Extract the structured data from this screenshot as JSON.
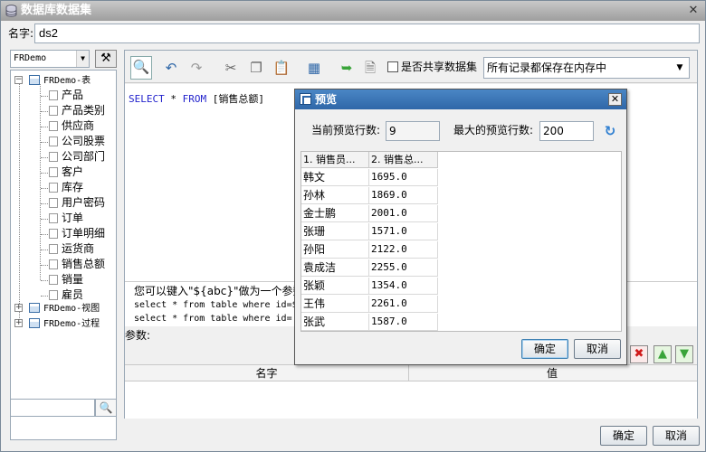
{
  "window": {
    "title": "数据库数据集",
    "close": "✕"
  },
  "name_field": {
    "label": "名字:",
    "value": "ds2"
  },
  "db_select": {
    "value": "FRDemo"
  },
  "tree": {
    "groups": [
      {
        "label": "FRDemo-表",
        "expanded": true
      },
      {
        "label": "FRDemo-视图",
        "expanded": false
      },
      {
        "label": "FRDemo-过程",
        "expanded": false
      }
    ],
    "tables": [
      "产品",
      "产品类别",
      "供应商",
      "公司股票",
      "公司部门",
      "客户",
      "库存",
      "用户密码",
      "订单",
      "订单明细",
      "运货商",
      "销售总额",
      "销量",
      "雇员"
    ]
  },
  "toolbar": {
    "share_label": "是否共享数据集",
    "memory_select": "所有记录都保存在内存中"
  },
  "sql": {
    "select": "SELECT",
    "star": " * ",
    "from": "FROM",
    "table": " [销售总额]"
  },
  "hint": {
    "line1": "您可以键入\"${abc}\"做为一个参数",
    "line2": "select * from table where id=${abc}",
    "line3": "select * from table where id='${abc}'"
  },
  "params": {
    "label": "参数:",
    "col_name": "名字",
    "col_value": "值"
  },
  "buttons": {
    "ok": "确定",
    "cancel": "取消"
  },
  "preview": {
    "title": "预览",
    "current_rows_label": "当前预览行数:",
    "current_rows_value": "9",
    "max_rows_label": "最大的预览行数:",
    "max_rows_value": "200",
    "columns": [
      "1. 销售员...",
      "2. 销售总..."
    ],
    "rows": [
      [
        "韩文",
        "1695.0"
      ],
      [
        "孙林",
        "1869.0"
      ],
      [
        "金士鹏",
        "2001.0"
      ],
      [
        "张珊",
        "1571.0"
      ],
      [
        "孙阳",
        "2122.0"
      ],
      [
        "袁成洁",
        "2255.0"
      ],
      [
        "张颖",
        "1354.0"
      ],
      [
        "王伟",
        "2261.0"
      ],
      [
        "张武",
        "1587.0"
      ]
    ],
    "ok": "确定",
    "cancel": "取消"
  },
  "colors": {
    "title_active": "#2f67a8",
    "refresh": "#2f7fd1",
    "delete": "#d01818",
    "arrow": "#3aa43a"
  }
}
